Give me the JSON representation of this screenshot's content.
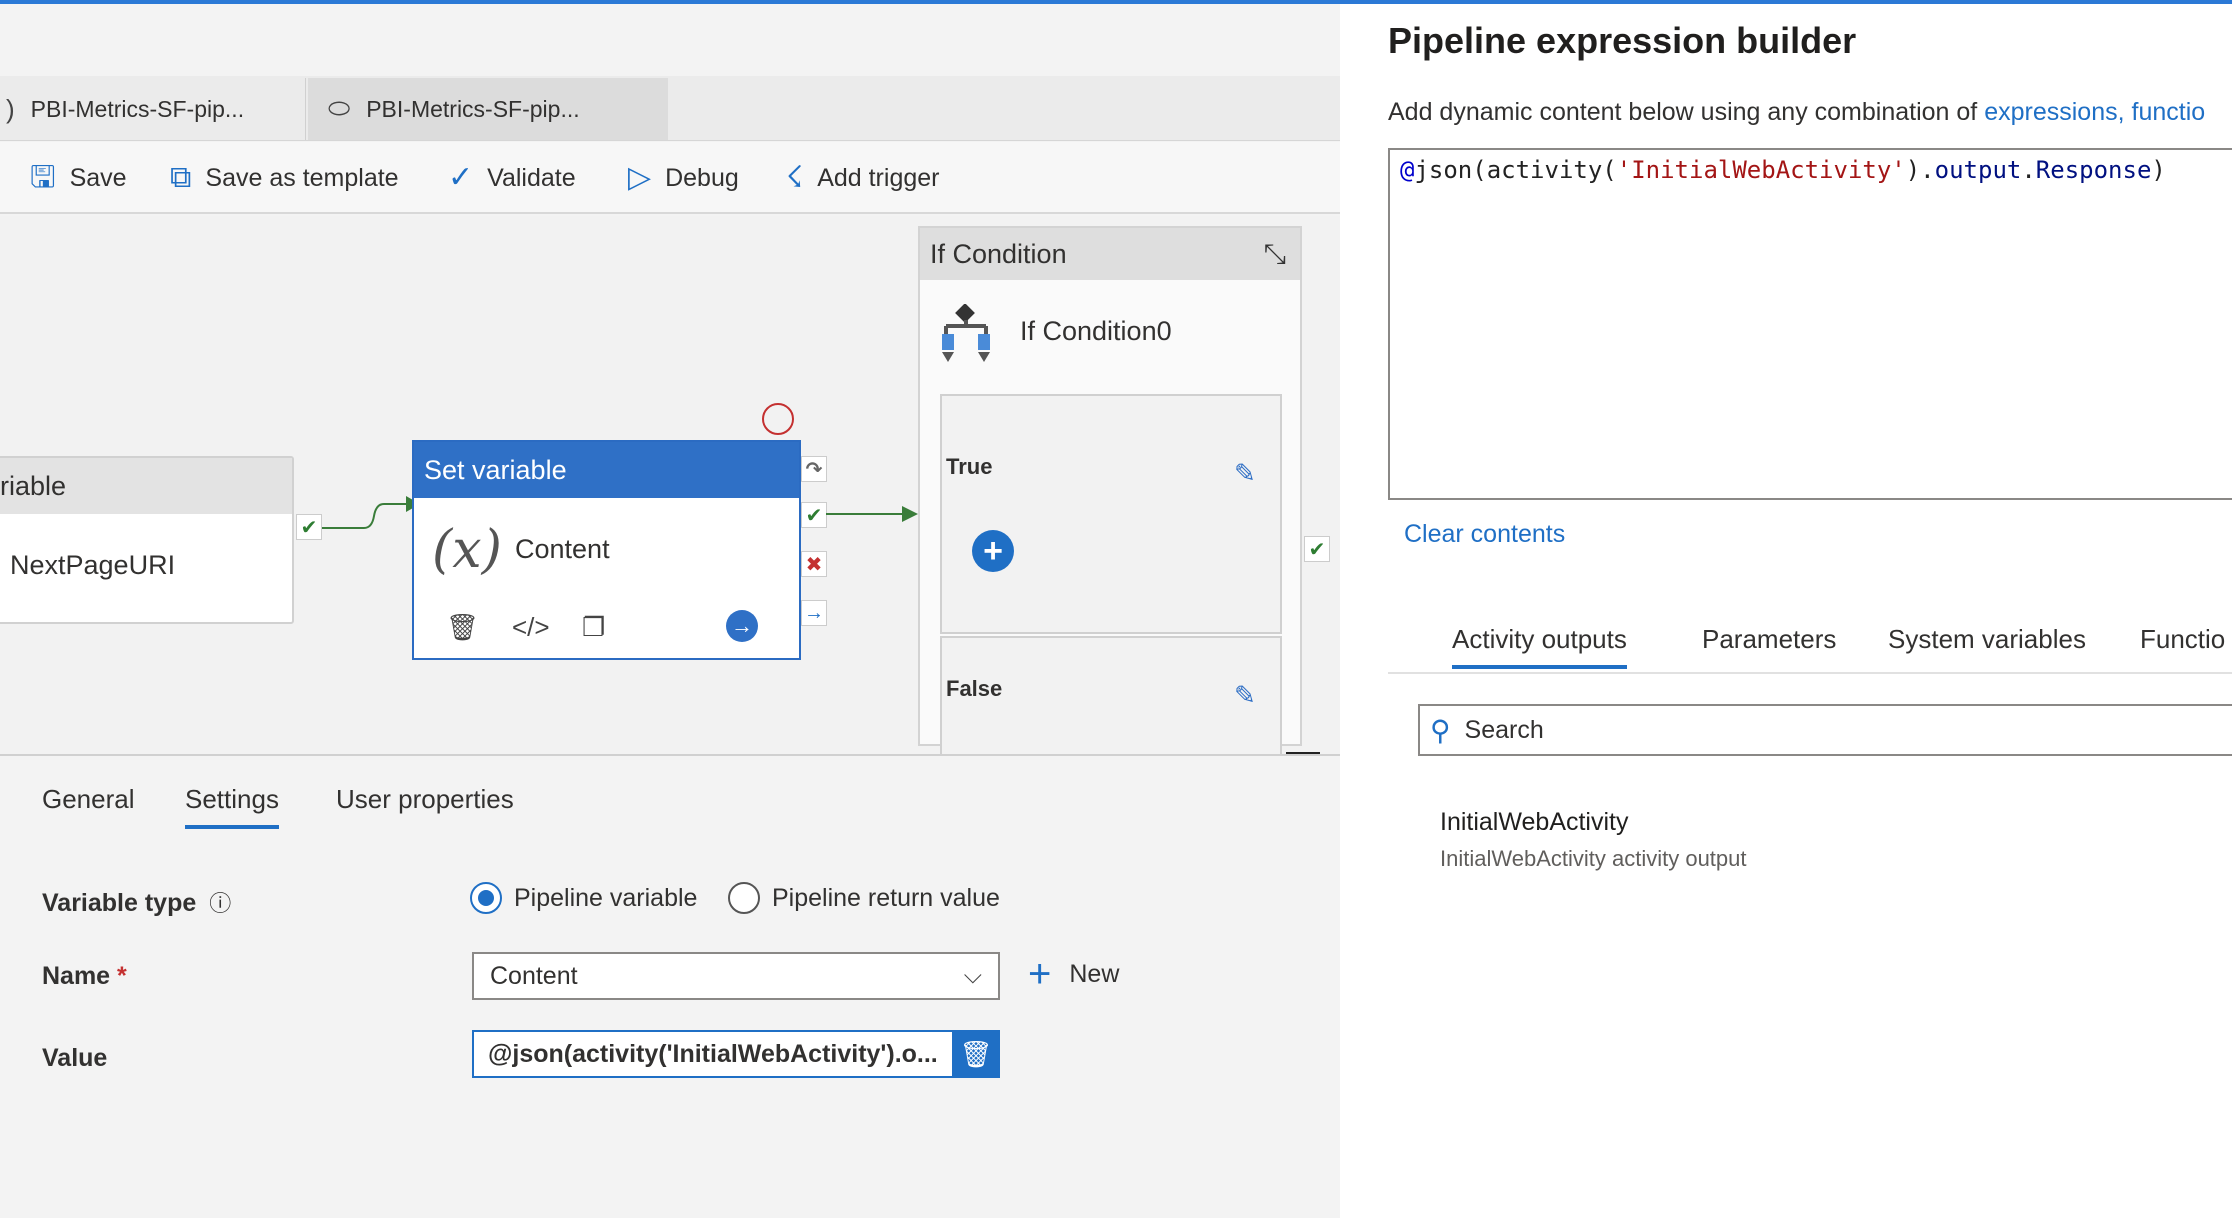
{
  "tabs": [
    {
      "label": "PBI-Metrics-SF-pip..."
    },
    {
      "label": "PBI-Metrics-SF-pip..."
    }
  ],
  "toolbar": {
    "save": "Save",
    "save_template": "Save as template",
    "validate": "Validate",
    "debug": "Debug",
    "add_trigger": "Add trigger"
  },
  "canvas": {
    "prev_activity": {
      "header": "riable",
      "name": "NextPageURI"
    },
    "set_variable": {
      "header": "Set variable",
      "icon_text": "(x)",
      "name": "Content"
    },
    "if_condition": {
      "header": "If Condition",
      "name": "If Condition0",
      "true_label": "True",
      "false_label": "False"
    }
  },
  "props": {
    "tabs": [
      "General",
      "Settings",
      "User properties"
    ],
    "active_tab": "Settings",
    "variable_type_label": "Variable type",
    "radio_pipeline_variable": "Pipeline variable",
    "radio_pipeline_return": "Pipeline return value",
    "name_label": "Name",
    "name_required": "*",
    "name_value": "Content",
    "new_label": "New",
    "value_label": "Value",
    "value_text": "@json(activity('InitialWebActivity').o..."
  },
  "builder": {
    "title": "Pipeline expression builder",
    "desc": "Add dynamic content below using any combination of ",
    "desc_link": "expressions, functio",
    "expr_at": "@",
    "expr_fn": "json(activity(",
    "expr_str": "'InitialWebActivity'",
    "expr_close": ").",
    "expr_prop1": "output",
    "expr_dot": ".",
    "expr_prop2": "Response",
    "expr_end": ")",
    "clear": "Clear contents",
    "tabs": [
      "Activity outputs",
      "Parameters",
      "System variables",
      "Functio"
    ],
    "search_placeholder": "Search",
    "output_item": "InitialWebActivity",
    "output_sub": "InitialWebActivity activity output"
  },
  "colors": {
    "accent": "#1f6fc5",
    "success": "#2e7d32",
    "error": "#c43030"
  }
}
